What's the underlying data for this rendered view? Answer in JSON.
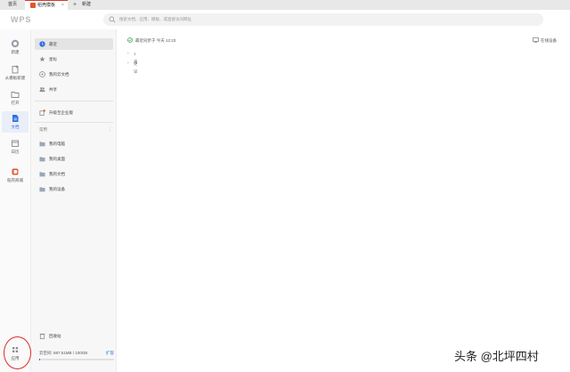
{
  "tabs": {
    "home": "首页",
    "template": "稻壳模板",
    "new": "新建"
  },
  "header": {
    "logo": "WPS",
    "search_placeholder": "搜索文档、应用、模板、或直接访问网址"
  },
  "leftnav": {
    "items": [
      {
        "label": "新建",
        "icon": "plus-circle-icon"
      },
      {
        "label": "从模板新建",
        "icon": "template-new-icon"
      },
      {
        "label": "打开",
        "icon": "folder-open-icon"
      },
      {
        "label": "文档",
        "icon": "document-icon"
      },
      {
        "label": "日历",
        "icon": "calendar-icon"
      },
      {
        "label": "稻壳商城",
        "icon": "docer-store-icon"
      }
    ],
    "apps": "应用"
  },
  "sidebar": {
    "items": [
      {
        "label": "最近",
        "icon": "clock-icon"
      },
      {
        "label": "星标",
        "icon": "star-icon"
      },
      {
        "label": "我的云文档",
        "icon": "cloud-doc-icon"
      },
      {
        "label": "共享",
        "icon": "share-people-icon"
      }
    ],
    "upgrade": "升级至企业版",
    "common_title": "常用",
    "common_items": [
      {
        "label": "我的电脑",
        "icon": "computer-folder-icon"
      },
      {
        "label": "我的桌面",
        "icon": "desktop-folder-icon"
      },
      {
        "label": "我的文档",
        "icon": "documents-folder-icon"
      },
      {
        "label": "我的设备",
        "icon": "device-folder-icon"
      }
    ],
    "recycle": "回收站",
    "storage_text": "云空间: 687.51MB / 100GB",
    "storage_expand": "扩容",
    "storage_fraction": 0.007
  },
  "main": {
    "sync_status": "最近同步于 今天 12:23",
    "online_devices": "在线设备",
    "groups": [
      "1月",
      "更早"
    ]
  },
  "watermark": "头条 @北坪四村",
  "colors": {
    "accent": "#2f6fe4",
    "active_tab_border": "#d23a2d",
    "annotation_circle": "#e02a2a"
  }
}
